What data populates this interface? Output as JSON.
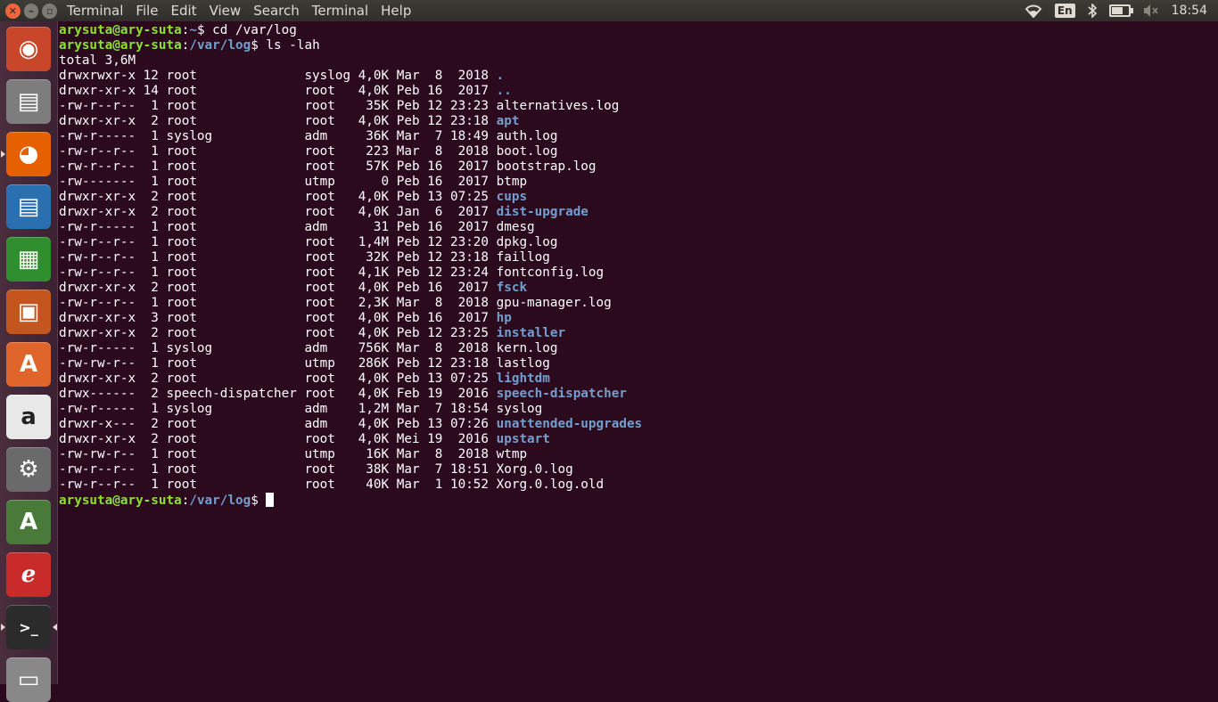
{
  "topbar": {
    "menu": [
      "Terminal",
      "File",
      "Edit",
      "View",
      "Search",
      "Terminal",
      "Help"
    ],
    "keyboard_layout": "En",
    "clock": "18:54",
    "icons": [
      "close-icon",
      "minimize-icon",
      "maximize-icon",
      "wifi-icon",
      "bluetooth-icon",
      "battery-icon",
      "volume-muted-icon"
    ],
    "battery_level": 0.75
  },
  "launcher": {
    "items": [
      {
        "name": "ubuntu-dash",
        "icon": "ubuntu-logo-icon",
        "color": "#c8472a"
      },
      {
        "name": "files",
        "icon": "file-cabinet-icon",
        "color": "#7d7d7d"
      },
      {
        "name": "firefox",
        "icon": "firefox-icon",
        "color": "#e66000"
      },
      {
        "name": "libreoffice-writer",
        "icon": "writer-document-icon",
        "color": "#2a6fb0"
      },
      {
        "name": "libreoffice-calc",
        "icon": "calc-spreadsheet-icon",
        "color": "#2f8f2f"
      },
      {
        "name": "libreoffice-impress",
        "icon": "impress-presentation-icon",
        "color": "#c4561d"
      },
      {
        "name": "software-center",
        "icon": "software-center-bag-icon",
        "color": "#e0652a"
      },
      {
        "name": "amazon",
        "icon": "amazon-logo-icon",
        "color": "#e8e8e8"
      },
      {
        "name": "system-settings",
        "icon": "settings-wrench-icon",
        "color": "#6a6a6a"
      },
      {
        "name": "software-updater",
        "icon": "software-updater-icon",
        "color": "#4a7a3a"
      },
      {
        "name": "document-viewer",
        "icon": "pdf-viewer-icon",
        "color": "#c92b2b"
      },
      {
        "name": "terminal",
        "icon": "terminal-icon",
        "color": "#2b2b2b"
      },
      {
        "name": "trash",
        "icon": "trash-icon",
        "color": "#888888"
      }
    ]
  },
  "terminal": {
    "prompt_user": "arysuta@ary-suta",
    "lines": [
      {
        "kind": "prompt",
        "path": "~",
        "cmd": "cd /var/log"
      },
      {
        "kind": "prompt",
        "path": "/var/log",
        "cmd": "ls -lah"
      },
      {
        "kind": "text",
        "text": "total 3,6M"
      }
    ],
    "entries": [
      {
        "perm": "drwxrwxr-x",
        "links": "12",
        "owner": "root",
        "group": "syslog",
        "size": "4,0K",
        "mon": "Mar",
        "day": "8",
        "time": "2018",
        "name": ".",
        "dir": true
      },
      {
        "perm": "drwxr-xr-x",
        "links": "14",
        "owner": "root",
        "group": "root",
        "size": "4,0K",
        "mon": "Peb",
        "day": "16",
        "time": "2017",
        "name": "..",
        "dir": true
      },
      {
        "perm": "-rw-r--r--",
        "links": "1",
        "owner": "root",
        "group": "root",
        "size": "35K",
        "mon": "Peb",
        "day": "12",
        "time": "23:23",
        "name": "alternatives.log",
        "dir": false
      },
      {
        "perm": "drwxr-xr-x",
        "links": "2",
        "owner": "root",
        "group": "root",
        "size": "4,0K",
        "mon": "Peb",
        "day": "12",
        "time": "23:18",
        "name": "apt",
        "dir": true
      },
      {
        "perm": "-rw-r-----",
        "links": "1",
        "owner": "syslog",
        "group": "adm",
        "size": "36K",
        "mon": "Mar",
        "day": "7",
        "time": "18:49",
        "name": "auth.log",
        "dir": false
      },
      {
        "perm": "-rw-r--r--",
        "links": "1",
        "owner": "root",
        "group": "root",
        "size": "223",
        "mon": "Mar",
        "day": "8",
        "time": "2018",
        "name": "boot.log",
        "dir": false
      },
      {
        "perm": "-rw-r--r--",
        "links": "1",
        "owner": "root",
        "group": "root",
        "size": "57K",
        "mon": "Peb",
        "day": "16",
        "time": "2017",
        "name": "bootstrap.log",
        "dir": false
      },
      {
        "perm": "-rw-------",
        "links": "1",
        "owner": "root",
        "group": "utmp",
        "size": "0",
        "mon": "Peb",
        "day": "16",
        "time": "2017",
        "name": "btmp",
        "dir": false
      },
      {
        "perm": "drwxr-xr-x",
        "links": "2",
        "owner": "root",
        "group": "root",
        "size": "4,0K",
        "mon": "Peb",
        "day": "13",
        "time": "07:25",
        "name": "cups",
        "dir": true
      },
      {
        "perm": "drwxr-xr-x",
        "links": "2",
        "owner": "root",
        "group": "root",
        "size": "4,0K",
        "mon": "Jan",
        "day": "6",
        "time": "2017",
        "name": "dist-upgrade",
        "dir": true
      },
      {
        "perm": "-rw-r-----",
        "links": "1",
        "owner": "root",
        "group": "adm",
        "size": "31",
        "mon": "Peb",
        "day": "16",
        "time": "2017",
        "name": "dmesg",
        "dir": false
      },
      {
        "perm": "-rw-r--r--",
        "links": "1",
        "owner": "root",
        "group": "root",
        "size": "1,4M",
        "mon": "Peb",
        "day": "12",
        "time": "23:20",
        "name": "dpkg.log",
        "dir": false
      },
      {
        "perm": "-rw-r--r--",
        "links": "1",
        "owner": "root",
        "group": "root",
        "size": "32K",
        "mon": "Peb",
        "day": "12",
        "time": "23:18",
        "name": "faillog",
        "dir": false
      },
      {
        "perm": "-rw-r--r--",
        "links": "1",
        "owner": "root",
        "group": "root",
        "size": "4,1K",
        "mon": "Peb",
        "day": "12",
        "time": "23:24",
        "name": "fontconfig.log",
        "dir": false
      },
      {
        "perm": "drwxr-xr-x",
        "links": "2",
        "owner": "root",
        "group": "root",
        "size": "4,0K",
        "mon": "Peb",
        "day": "16",
        "time": "2017",
        "name": "fsck",
        "dir": true
      },
      {
        "perm": "-rw-r--r--",
        "links": "1",
        "owner": "root",
        "group": "root",
        "size": "2,3K",
        "mon": "Mar",
        "day": "8",
        "time": "2018",
        "name": "gpu-manager.log",
        "dir": false
      },
      {
        "perm": "drwxr-xr-x",
        "links": "3",
        "owner": "root",
        "group": "root",
        "size": "4,0K",
        "mon": "Peb",
        "day": "16",
        "time": "2017",
        "name": "hp",
        "dir": true
      },
      {
        "perm": "drwxr-xr-x",
        "links": "2",
        "owner": "root",
        "group": "root",
        "size": "4,0K",
        "mon": "Peb",
        "day": "12",
        "time": "23:25",
        "name": "installer",
        "dir": true
      },
      {
        "perm": "-rw-r-----",
        "links": "1",
        "owner": "syslog",
        "group": "adm",
        "size": "756K",
        "mon": "Mar",
        "day": "8",
        "time": "2018",
        "name": "kern.log",
        "dir": false
      },
      {
        "perm": "-rw-rw-r--",
        "links": "1",
        "owner": "root",
        "group": "utmp",
        "size": "286K",
        "mon": "Peb",
        "day": "12",
        "time": "23:18",
        "name": "lastlog",
        "dir": false
      },
      {
        "perm": "drwxr-xr-x",
        "links": "2",
        "owner": "root",
        "group": "root",
        "size": "4,0K",
        "mon": "Peb",
        "day": "13",
        "time": "07:25",
        "name": "lightdm",
        "dir": true
      },
      {
        "perm": "drwx------",
        "links": "2",
        "owner": "speech-dispatcher",
        "group": "root",
        "size": "4,0K",
        "mon": "Feb",
        "day": "19",
        "time": "2016",
        "name": "speech-dispatcher",
        "dir": true
      },
      {
        "perm": "-rw-r-----",
        "links": "1",
        "owner": "syslog",
        "group": "adm",
        "size": "1,2M",
        "mon": "Mar",
        "day": "7",
        "time": "18:54",
        "name": "syslog",
        "dir": false
      },
      {
        "perm": "drwxr-x---",
        "links": "2",
        "owner": "root",
        "group": "adm",
        "size": "4,0K",
        "mon": "Peb",
        "day": "13",
        "time": "07:26",
        "name": "unattended-upgrades",
        "dir": true
      },
      {
        "perm": "drwxr-xr-x",
        "links": "2",
        "owner": "root",
        "group": "root",
        "size": "4,0K",
        "mon": "Mei",
        "day": "19",
        "time": "2016",
        "name": "upstart",
        "dir": true
      },
      {
        "perm": "-rw-rw-r--",
        "links": "1",
        "owner": "root",
        "group": "utmp",
        "size": "16K",
        "mon": "Mar",
        "day": "8",
        "time": "2018",
        "name": "wtmp",
        "dir": false
      },
      {
        "perm": "-rw-r--r--",
        "links": "1",
        "owner": "root",
        "group": "root",
        "size": "38K",
        "mon": "Mar",
        "day": "7",
        "time": "18:51",
        "name": "Xorg.0.log",
        "dir": false
      },
      {
        "perm": "-rw-r--r--",
        "links": "1",
        "owner": "root",
        "group": "root",
        "size": "40K",
        "mon": "Mar",
        "day": "1",
        "time": "10:52",
        "name": "Xorg.0.log.old",
        "dir": false
      }
    ],
    "final_prompt_path": "/var/log",
    "colors": {
      "user": "#8ae234",
      "directory": "#729fcf",
      "background": "#2c0a1e",
      "text": "#ffffff"
    }
  }
}
